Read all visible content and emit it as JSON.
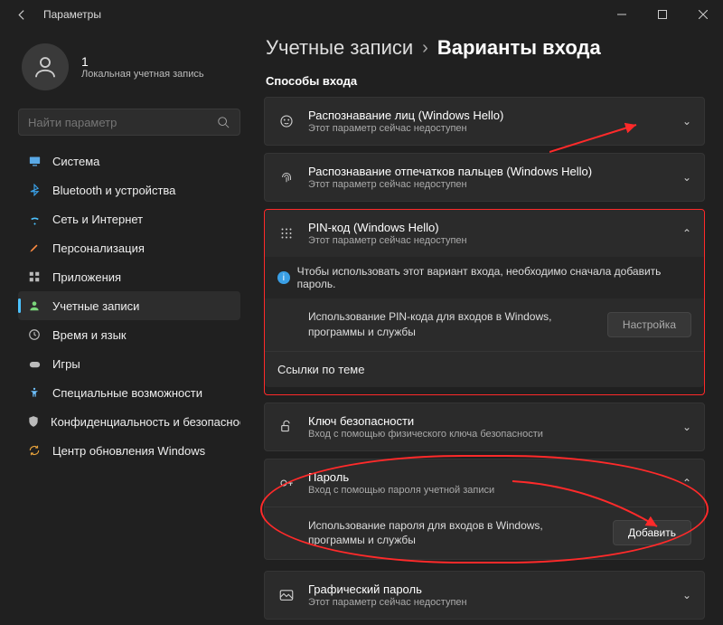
{
  "window": {
    "title": "Параметры"
  },
  "user": {
    "name": "1",
    "sub": "Локальная учетная запись"
  },
  "search": {
    "placeholder": "Найти параметр"
  },
  "nav": [
    {
      "id": "system",
      "label": "Система",
      "icon": "🖥",
      "color": "#5aa9e6"
    },
    {
      "id": "bluetooth",
      "label": "Bluetooth и устройства",
      "icon": "bt",
      "color": "#3a9fe5"
    },
    {
      "id": "network",
      "label": "Сеть и Интернет",
      "icon": "wifi",
      "color": "#4cc2ff"
    },
    {
      "id": "personalization",
      "label": "Персонализация",
      "icon": "brush",
      "color": "#ff8c42"
    },
    {
      "id": "apps",
      "label": "Приложения",
      "icon": "grid",
      "color": "#bbb"
    },
    {
      "id": "accounts",
      "label": "Учетные записи",
      "icon": "user",
      "color": "#7bd67b",
      "active": true
    },
    {
      "id": "time",
      "label": "Время и язык",
      "icon": "clock",
      "color": "#bbb"
    },
    {
      "id": "gaming",
      "label": "Игры",
      "icon": "game",
      "color": "#bbb"
    },
    {
      "id": "accessibility",
      "label": "Специальные возможности",
      "icon": "access",
      "color": "#6ec1ff"
    },
    {
      "id": "privacy",
      "label": "Конфиденциальность и безопасность",
      "icon": "shield",
      "color": "#bbb"
    },
    {
      "id": "update",
      "label": "Центр обновления Windows",
      "icon": "update",
      "color": "#e6a23c"
    }
  ],
  "crumbs": {
    "a": "Учетные записи",
    "b": "Варианты входа"
  },
  "section": "Способы входа",
  "opts": {
    "face": {
      "title": "Распознавание лиц (Windows Hello)",
      "sub": "Этот параметр сейчас недоступен"
    },
    "finger": {
      "title": "Распознавание отпечатков пальцев (Windows Hello)",
      "sub": "Этот параметр сейчас недоступен"
    },
    "pin": {
      "title": "PIN-код (Windows Hello)",
      "sub": "Этот параметр сейчас недоступен",
      "info": "Чтобы использовать этот вариант входа, необходимо сначала добавить пароль.",
      "desc": "Использование PIN-кода для входов в Windows, программы и службы",
      "btn": "Настройка",
      "links": "Ссылки по теме"
    },
    "key": {
      "title": "Ключ безопасности",
      "sub": "Вход с помощью физического ключа безопасности"
    },
    "password": {
      "title": "Пароль",
      "sub": "Вход с помощью пароля учетной записи",
      "desc": "Использование пароля для входов в Windows, программы и службы",
      "btn": "Добавить"
    },
    "picture": {
      "title": "Графический пароль",
      "sub": "Этот параметр сейчас недоступен"
    }
  }
}
